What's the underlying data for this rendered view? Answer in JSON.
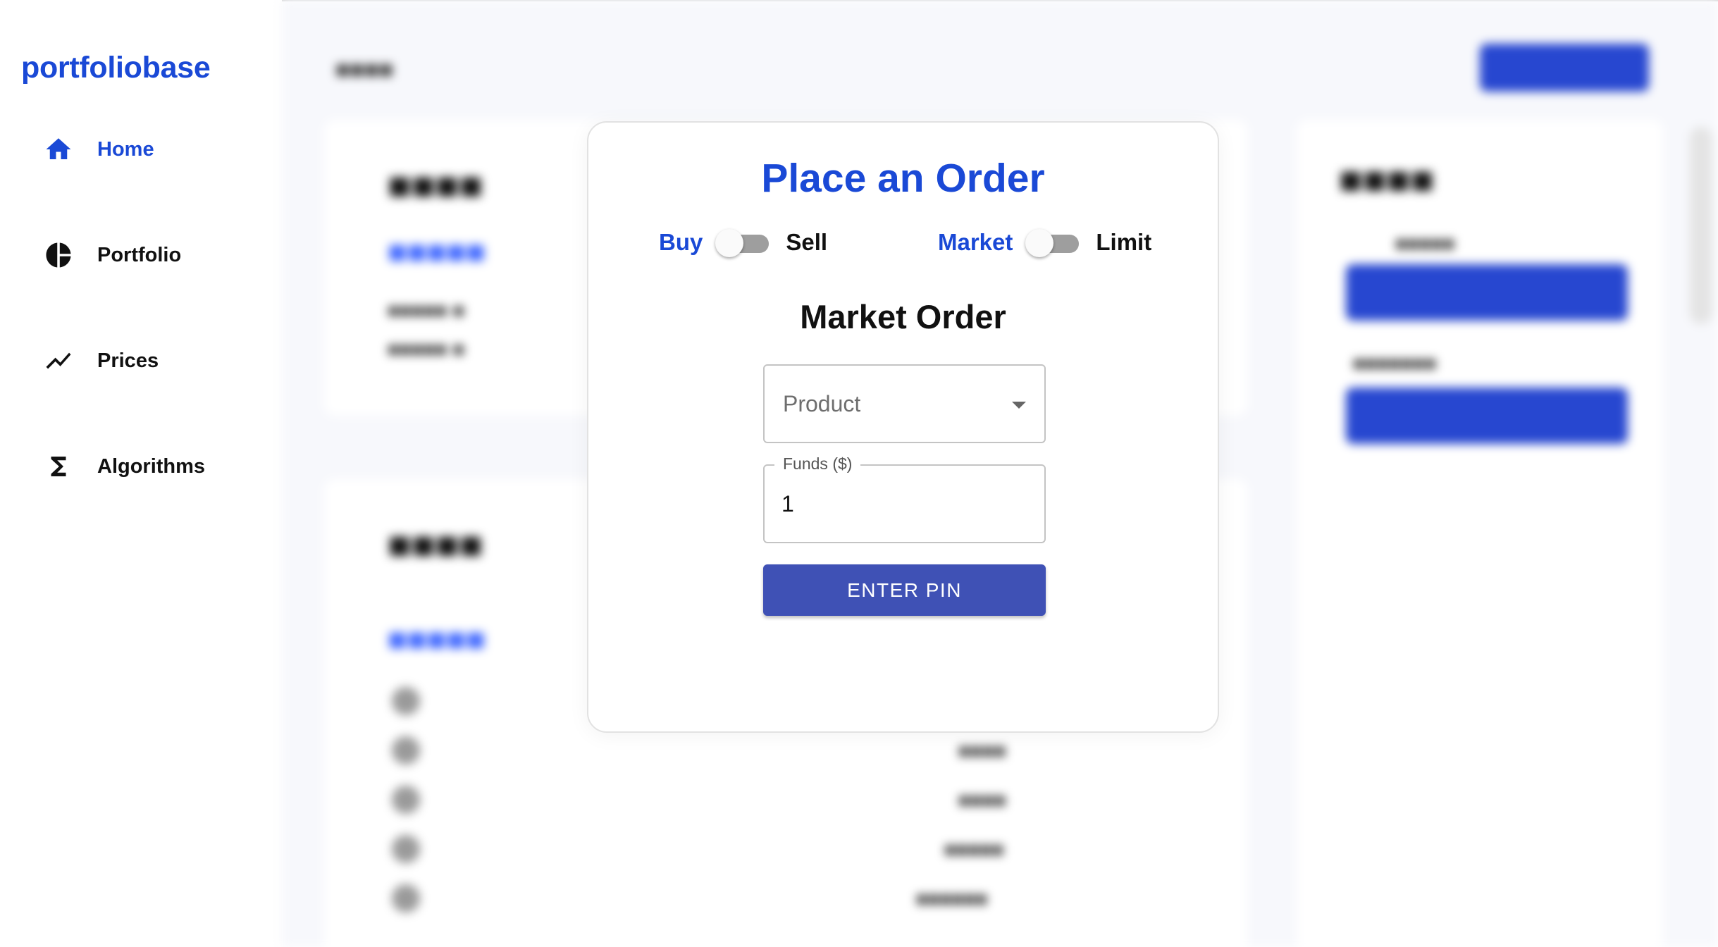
{
  "app": {
    "logo": "portfoliobase",
    "accent_color": "#1a49d6",
    "button_color": "#3f51b5"
  },
  "sidebar": {
    "items": [
      {
        "label": "Home",
        "icon": "home-icon",
        "active": true
      },
      {
        "label": "Portfolio",
        "icon": "pie-chart-icon",
        "active": false
      },
      {
        "label": "Prices",
        "icon": "trend-line-icon",
        "active": false
      },
      {
        "label": "Algorithms",
        "icon": "sigma-icon",
        "active": false
      }
    ]
  },
  "modal": {
    "title": "Place an Order",
    "side_toggle": {
      "left": "Buy",
      "right": "Sell",
      "selected": "Buy"
    },
    "type_toggle": {
      "left": "Market",
      "right": "Limit",
      "selected": "Market"
    },
    "section_title": "Market Order",
    "product_select": {
      "placeholder": "Product"
    },
    "funds_field": {
      "label": "Funds ($)",
      "value": "1"
    },
    "submit_label": "ENTER PIN"
  }
}
